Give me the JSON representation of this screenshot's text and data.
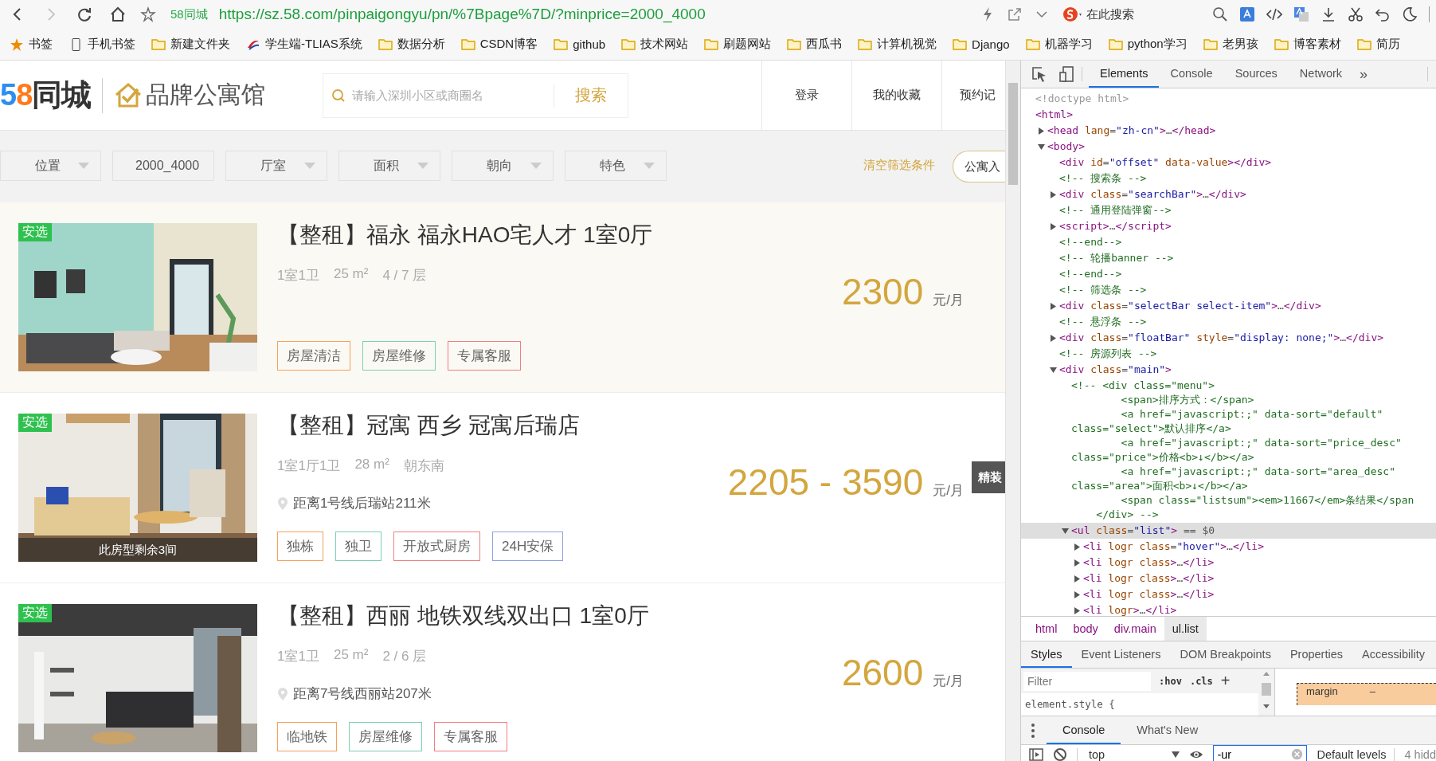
{
  "browser": {
    "nav_buttons": [
      {
        "kind": "back",
        "disabled": false
      },
      {
        "kind": "forward",
        "disabled": true
      },
      {
        "kind": "reload",
        "disabled": false
      },
      {
        "kind": "home",
        "disabled": false
      }
    ],
    "site_badge": "58同城",
    "url": {
      "scheme": "https://",
      "host": "sz.58.com",
      "path": "/pinpaigongyu/pn/%7Bpage%7D/?minprice=2000_4000"
    },
    "search_placeholder": "在此搜索",
    "bookmarks": [
      {
        "kind": "star",
        "label": "书签"
      },
      {
        "kind": "device",
        "label": "手机书签"
      },
      {
        "kind": "folder",
        "label": "新建文件夹"
      },
      {
        "kind": "site",
        "label": "学生端-TLIAS系统"
      },
      {
        "kind": "folder",
        "label": "数据分析"
      },
      {
        "kind": "folder",
        "label": "CSDN博客"
      },
      {
        "kind": "folder",
        "label": "github"
      },
      {
        "kind": "folder",
        "label": "技术网站"
      },
      {
        "kind": "folder",
        "label": "刷题网站"
      },
      {
        "kind": "folder",
        "label": "西瓜书"
      },
      {
        "kind": "folder",
        "label": "计算机视觉"
      },
      {
        "kind": "folder",
        "label": "Django"
      },
      {
        "kind": "folder",
        "label": "机器学习"
      },
      {
        "kind": "folder",
        "label": "python学习"
      },
      {
        "kind": "folder",
        "label": "老男孩"
      },
      {
        "kind": "folder",
        "label": "博客素材"
      },
      {
        "kind": "folder",
        "label": "简历"
      }
    ]
  },
  "page": {
    "header": {
      "logo_digits": "58",
      "logo_name": "同城",
      "brand": "品牌公寓馆",
      "search_placeholder": "请输入深圳小区或商圈名",
      "search_button": "搜索",
      "links": [
        "登录",
        "我的收藏",
        "预约记"
      ]
    },
    "filters": {
      "dropdowns": [
        "位置",
        "2000_4000",
        "厅室",
        "面积",
        "朝向",
        "特色"
      ],
      "clear": "清空筛选条件",
      "join": "公寓入"
    },
    "listings": [
      {
        "hovered": true,
        "badge": "安选",
        "title": "【整租】福永 福永HAO宅人才 1室0厅",
        "specs": [
          "1室1卫",
          "25 m²",
          "4 / 7 层"
        ],
        "price": "2300",
        "unit": "元/月",
        "tags": [
          {
            "text": "房屋清洁",
            "color": "#f3a25c"
          },
          {
            "text": "房屋维修",
            "color": "#7ccfb3"
          },
          {
            "text": "专属客服",
            "color": "#ee8080"
          }
        ]
      },
      {
        "hovered": false,
        "badge": "安选",
        "title": "【整租】冠寓 西乡 冠寓后瑞店",
        "specs": [
          "1室1厅1卫",
          "28 m²",
          "朝东南"
        ],
        "distance": "距离1号线后瑞站211米",
        "remaining": "此房型剩余3间",
        "price": "2205 - 3590",
        "unit": "元/月",
        "tags": [
          {
            "text": "独栋",
            "color": "#f3a25c"
          },
          {
            "text": "独卫",
            "color": "#7ccfb3"
          },
          {
            "text": "开放式厨房",
            "color": "#ee8080"
          },
          {
            "text": "24H安保",
            "color": "#8ea3e0"
          }
        ]
      },
      {
        "hovered": false,
        "badge": "安选",
        "title": "【整租】西丽 地铁双线双出口 1室0厅",
        "specs": [
          "1室1卫",
          "25 m²",
          "2 / 6 层"
        ],
        "distance": "距离7号线西丽站207米",
        "price": "2600",
        "unit": "元/月",
        "tags": [
          {
            "text": "临地铁",
            "color": "#f3a25c"
          },
          {
            "text": "房屋维修",
            "color": "#7ccfb3"
          },
          {
            "text": "专属客服",
            "color": "#ee8080"
          }
        ]
      }
    ],
    "side_tab": "精装"
  },
  "devtools": {
    "tabs": [
      {
        "label": "Elements",
        "selected": true
      },
      {
        "label": "Console",
        "selected": false
      },
      {
        "label": "Sources",
        "selected": false
      },
      {
        "label": "Network",
        "selected": false
      }
    ],
    "more_tabs": "»",
    "tree": [
      {
        "kind": "doctype",
        "text": "<!doctype html>",
        "selected": false
      },
      {
        "kind": "element",
        "text": "<html>",
        "selected": false,
        "children": [
          {
            "kind": "element",
            "text": "<head lang=\"zh-cn\">…</head>",
            "expanded": false,
            "selected": false
          },
          {
            "kind": "element",
            "text": "<body>",
            "expanded": true,
            "selected": false,
            "children": [
              {
                "kind": "element",
                "text": "<div id=\"offset\" data-value></div>",
                "selected": false
              },
              {
                "kind": "comment",
                "text": "<!-- 搜索条 -->",
                "selected": false
              },
              {
                "kind": "element",
                "text": "<div class=\"searchBar\">…</div>",
                "expanded": false,
                "selected": false
              },
              {
                "kind": "comment",
                "text": "<!-- 通用登陆弹窗-->",
                "selected": false
              },
              {
                "kind": "element",
                "text": "<script>…</script>",
                "expanded": false,
                "selected": false
              },
              {
                "kind": "comment",
                "text": "<!--end-->",
                "selected": false
              },
              {
                "kind": "comment",
                "text": "<!-- 轮播banner -->",
                "selected": false
              },
              {
                "kind": "comment",
                "text": "<!--end-->",
                "selected": false
              },
              {
                "kind": "comment",
                "text": "<!-- 筛选条 -->",
                "selected": false
              },
              {
                "kind": "element",
                "text": "<div class=\"selectBar select-item\">…</div>",
                "expanded": false,
                "selected": false
              },
              {
                "kind": "comment",
                "text": "<!-- 悬浮条 -->",
                "selected": false
              },
              {
                "kind": "element",
                "text": "<div class=\"floatBar\" style=\"display: none;\">…</div>",
                "expanded": false,
                "selected": false
              },
              {
                "kind": "comment",
                "text": "<!-- 房源列表 -->",
                "selected": false
              },
              {
                "kind": "element",
                "text": "<div class=\"main\">",
                "expanded": true,
                "selected": false,
                "children": [
                  {
                    "kind": "comment",
                    "selected": false,
                    "lines": [
                      "<!-- <div class=\"menu\">",
                      "        <span>排序方式：</span>",
                      "        <a href=\"javascript:;\" data-sort=\"default\"",
                      "class=\"select\">默认排序</a>",
                      "        <a href=\"javascript:;\" data-sort=\"price_desc\"",
                      "class=\"price\">价格<b>↓</b></a>",
                      "        <a href=\"javascript:;\" data-sort=\"area_desc\"",
                      "class=\"area\">面积<b>↓</b></a>",
                      "        <span class=\"listsum\"><em>11667</em>条结果</span",
                      "    </div> -->"
                    ]
                  },
                  {
                    "kind": "element",
                    "text": "<ul class=\"list\"> == $0",
                    "expanded": true,
                    "selected": true,
                    "children": [
                      {
                        "kind": "element",
                        "text": "<li logr class=\"hover\">…</li>",
                        "expanded": false,
                        "selected": false
                      },
                      {
                        "kind": "element",
                        "text": "<li logr class>…</li>",
                        "expanded": false,
                        "selected": false
                      },
                      {
                        "kind": "element",
                        "text": "<li logr class>…</li>",
                        "expanded": false,
                        "selected": false
                      },
                      {
                        "kind": "element",
                        "text": "<li logr class>…</li>",
                        "expanded": false,
                        "selected": false
                      },
                      {
                        "kind": "element",
                        "text": "<li logr>…</li>",
                        "expanded": false,
                        "selected": false
                      }
                    ]
                  }
                ]
              }
            ]
          }
        ]
      }
    ],
    "breadcrumbs": [
      {
        "label": "html",
        "selected": false
      },
      {
        "label": "body",
        "selected": false
      },
      {
        "label": "div.main",
        "selected": false
      },
      {
        "label": "ul.list",
        "selected": true
      }
    ],
    "style_tabs": [
      {
        "label": "Styles",
        "selected": true
      },
      {
        "label": "Event Listeners",
        "selected": false
      },
      {
        "label": "DOM Breakpoints",
        "selected": false
      },
      {
        "label": "Properties",
        "selected": false
      },
      {
        "label": "Accessibility",
        "selected": false
      }
    ],
    "styles": {
      "filter_placeholder": "Filter",
      "hov": ":hov",
      "cls": ".cls",
      "add": "+",
      "rule": "element.style {",
      "box_label": "margin",
      "box_value": "–"
    },
    "drawer_tabs": [
      {
        "label": "Console",
        "selected": true
      },
      {
        "label": "What's New",
        "selected": false
      }
    ],
    "console_bar": {
      "context": "top",
      "filter_value": "-ur",
      "levels": "Default levels",
      "hidden": "4 hidd"
    }
  }
}
